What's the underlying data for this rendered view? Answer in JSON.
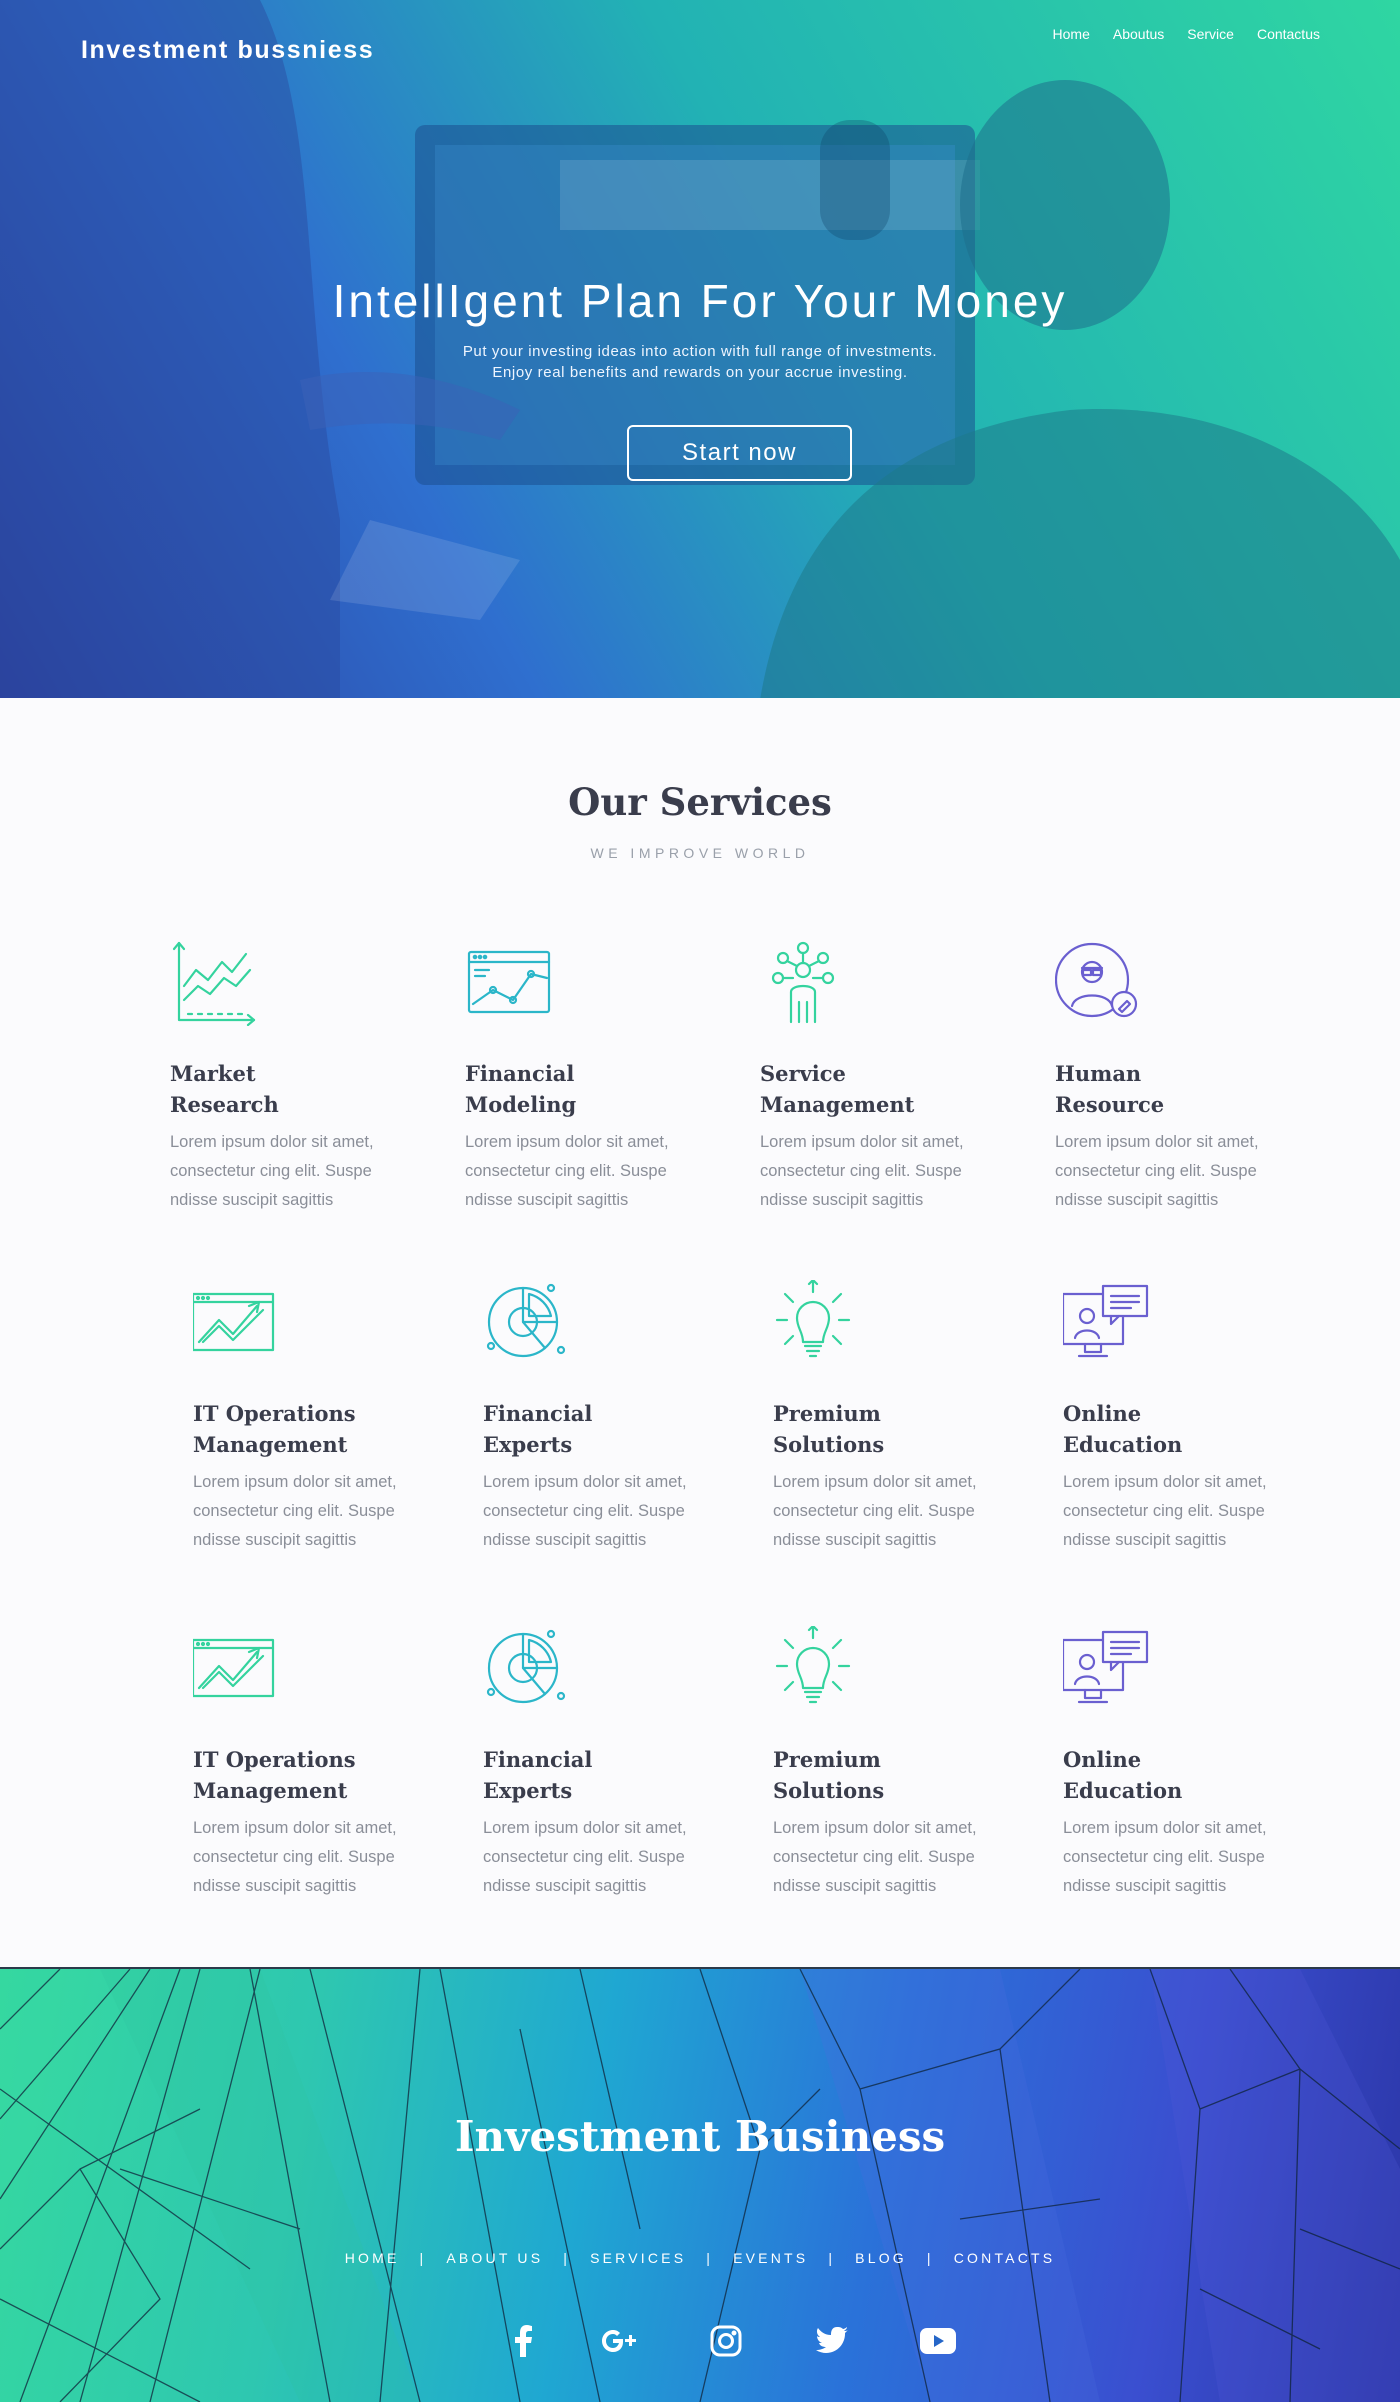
{
  "header": {
    "brand": "Investment bussniess",
    "nav": [
      "Home",
      "Aboutus",
      "Service",
      "Contactus"
    ]
  },
  "hero": {
    "title": "IntellIgent Plan For Your Money",
    "subtitle_line1": "Put your investing ideas into action with full range of investments.",
    "subtitle_line2": "Enjoy real benefits and rewards on your accrue investing.",
    "cta_label": "Start now"
  },
  "services": {
    "title": "Our Services",
    "subtitle": "WE IMPROVE WORLD",
    "items": [
      {
        "title_l1": "Market",
        "title_l2": "Research",
        "icon": "chart-growth-icon",
        "text": "Lorem ipsum dolor sit amet, consectetur cing elit. Suspe ndisse suscipit sagittis"
      },
      {
        "title_l1": "Financial",
        "title_l2": "Modeling",
        "icon": "browser-line-chart-icon",
        "text": "Lorem ipsum dolor sit amet, consectetur cing elit. Suspe ndisse suscipit sagittis"
      },
      {
        "title_l1": "Service",
        "title_l2": "Management",
        "icon": "network-person-icon",
        "text": "Lorem ipsum dolor sit amet, consectetur cing elit. Suspe ndisse suscipit sagittis"
      },
      {
        "title_l1": "Human",
        "title_l2": "Resource",
        "icon": "person-edit-icon",
        "text": "Lorem ipsum dolor sit amet, consectetur cing elit. Suspe ndisse suscipit sagittis"
      },
      {
        "title_l1": "IT Operations",
        "title_l2": "Management",
        "icon": "window-trend-icon",
        "text": "Lorem ipsum dolor sit amet, consectetur cing elit. Suspe ndisse suscipit sagittis"
      },
      {
        "title_l1": "Financial",
        "title_l2": "Experts",
        "icon": "pie-chart-icon",
        "text": "Lorem ipsum dolor sit amet, consectetur cing elit. Suspe ndisse suscipit sagittis"
      },
      {
        "title_l1": "Premium",
        "title_l2": "Solutions",
        "icon": "lightbulb-icon",
        "text": "Lorem ipsum dolor sit amet, consectetur cing elit. Suspe ndisse suscipit sagittis"
      },
      {
        "title_l1": "Online",
        "title_l2": "Education",
        "icon": "monitor-chat-icon",
        "text": "Lorem ipsum dolor sit amet, consectetur cing elit. Suspe ndisse suscipit sagittis"
      },
      {
        "title_l1": "IT Operations",
        "title_l2": "Management",
        "icon": "window-trend-icon",
        "text": "Lorem ipsum dolor sit amet, consectetur cing elit. Suspe ndisse suscipit sagittis"
      },
      {
        "title_l1": "Financial",
        "title_l2": "Experts",
        "icon": "pie-chart-icon",
        "text": "Lorem ipsum dolor sit amet, consectetur cing elit. Suspe ndisse suscipit sagittis"
      },
      {
        "title_l1": "Premium",
        "title_l2": "Solutions",
        "icon": "lightbulb-icon",
        "text": "Lorem ipsum dolor sit amet, consectetur cing elit. Suspe ndisse suscipit sagittis"
      },
      {
        "title_l1": "Online",
        "title_l2": "Education",
        "icon": "monitor-chat-icon",
        "text": "Lorem ipsum dolor sit amet, consectetur cing elit. Suspe ndisse suscipit sagittis"
      }
    ]
  },
  "footer": {
    "title": "Investment Business",
    "nav": [
      "HOME",
      "ABOUT US",
      "SERVICES",
      "EVENTS",
      "BLOG",
      "CONTACTS"
    ],
    "separator": "|",
    "socials": [
      "facebook-icon",
      "google-plus-icon",
      "instagram-icon",
      "twitter-icon",
      "youtube-icon"
    ]
  },
  "colors": {
    "green_accent": "#34d39e",
    "teal_accent": "#2bb6c9",
    "purple_accent": "#6a5fd0",
    "heading": "#3a3d4c",
    "body_text": "#8a8e98"
  }
}
